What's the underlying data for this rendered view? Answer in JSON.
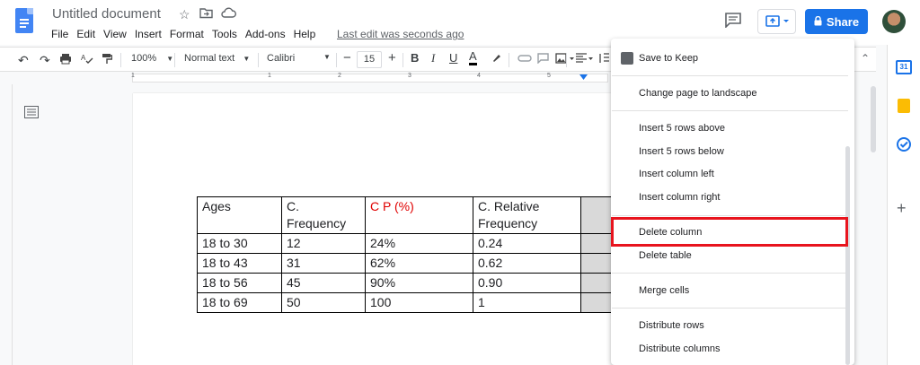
{
  "app": {
    "title": "Untitled document",
    "menu": [
      "File",
      "Edit",
      "View",
      "Insert",
      "Format",
      "Tools",
      "Add-ons",
      "Help"
    ],
    "last_edit": "Last edit was seconds ago",
    "share_label": "Share"
  },
  "toolbar": {
    "zoom": "100%",
    "style": "Normal text",
    "font": "Calibri",
    "font_size": "15"
  },
  "ruler": {
    "marks": [
      "1",
      "1",
      "2",
      "3",
      "4",
      "5"
    ]
  },
  "table": {
    "headers": [
      [
        "Ages",
        ""
      ],
      [
        "C.",
        "Frequency"
      ],
      [
        "C P (%)",
        ""
      ],
      [
        "C. Relative",
        "Frequency"
      ]
    ],
    "rows": [
      [
        "18 to 30",
        "12",
        "24%",
        "0.24"
      ],
      [
        "18 to 43",
        "31",
        "62%",
        "0.62"
      ],
      [
        "18 to 56",
        "45",
        "90%",
        "0.90"
      ],
      [
        "18 to 69",
        "50",
        "100",
        "1"
      ]
    ]
  },
  "context_menu": {
    "save_to_keep": "Save to Keep",
    "landscape": "Change page to landscape",
    "insert_above": "Insert 5 rows above",
    "insert_below": "Insert 5 rows below",
    "insert_left": "Insert column left",
    "insert_right": "Insert column right",
    "delete_column": "Delete column",
    "delete_table": "Delete table",
    "merge_cells": "Merge cells",
    "distribute_rows": "Distribute rows",
    "distribute_columns": "Distribute columns"
  },
  "colors": {
    "accent": "#1a73e8",
    "highlight": "#e8141e",
    "red_text": "#e00000"
  }
}
